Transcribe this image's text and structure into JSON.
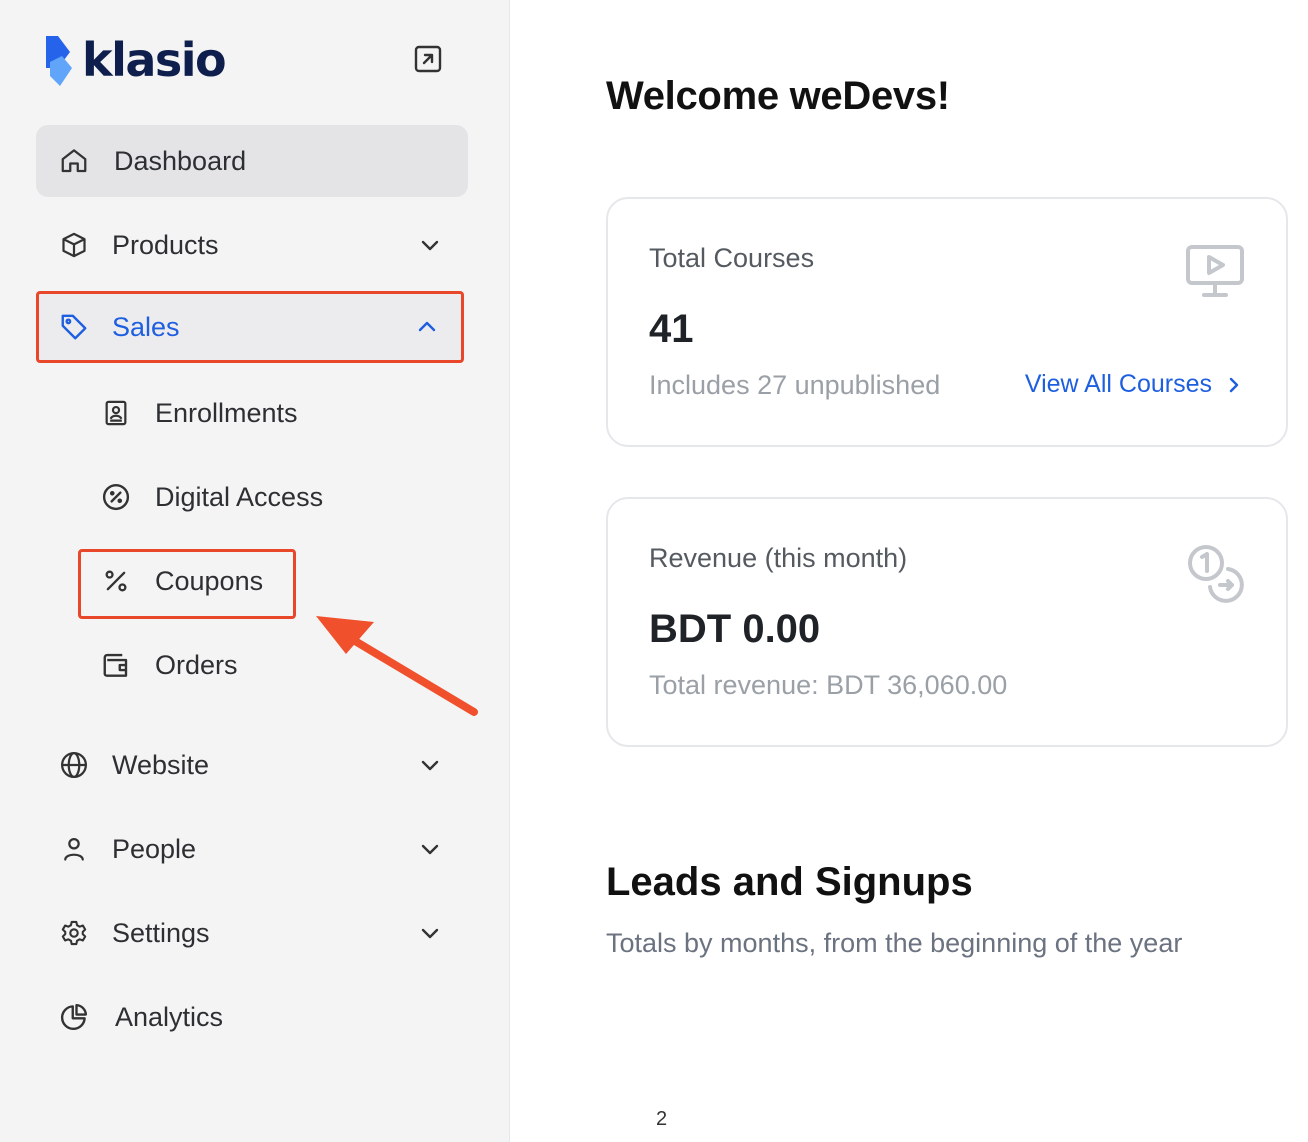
{
  "brand": {
    "name": "klasio",
    "mark_color": "#2563eb",
    "text_color": "#0f1f4d"
  },
  "sidebar": {
    "items": [
      {
        "id": "dashboard",
        "label": "Dashboard",
        "icon": "home-icon",
        "active": true
      },
      {
        "id": "products",
        "label": "Products",
        "icon": "box-icon",
        "expandable": true,
        "expanded": false
      },
      {
        "id": "sales",
        "label": "Sales",
        "icon": "tag-icon",
        "expandable": true,
        "expanded": true,
        "highlighted": true,
        "children": [
          {
            "id": "enrollments",
            "label": "Enrollments",
            "icon": "contact-book-icon"
          },
          {
            "id": "digital-access",
            "label": "Digital Access",
            "icon": "circle-percent-icon"
          },
          {
            "id": "coupons",
            "label": "Coupons",
            "icon": "percent-icon",
            "highlighted": true
          },
          {
            "id": "orders",
            "label": "Orders",
            "icon": "wallet-icon"
          }
        ]
      },
      {
        "id": "website",
        "label": "Website",
        "icon": "globe-icon",
        "expandable": true,
        "expanded": false
      },
      {
        "id": "people",
        "label": "People",
        "icon": "user-icon",
        "expandable": true,
        "expanded": false
      },
      {
        "id": "settings",
        "label": "Settings",
        "icon": "gear-icon",
        "expandable": true,
        "expanded": false
      },
      {
        "id": "analytics",
        "label": "Analytics",
        "icon": "pie-chart-icon"
      }
    ]
  },
  "main": {
    "title": "Welcome weDevs!",
    "cards": [
      {
        "label": "Total Courses",
        "value": "41",
        "sub": "Includes 27 unpublished",
        "link": "View All Courses",
        "icon": "monitor-play-icon"
      },
      {
        "label": "Revenue (this month)",
        "value": "BDT 0.00",
        "sub": "Total revenue: BDT 36,060.00",
        "icon": "coins-icon"
      }
    ],
    "section": {
      "title": "Leads and Signups",
      "subtitle": "Totals by months, from the beginning of the year"
    },
    "chart_axis_tick": "2"
  },
  "colors": {
    "accent": "#1e5fe0",
    "annotation": "#e8472a",
    "sidebar_bg": "#f4f4f5",
    "active_bg": "#e4e4e7"
  }
}
